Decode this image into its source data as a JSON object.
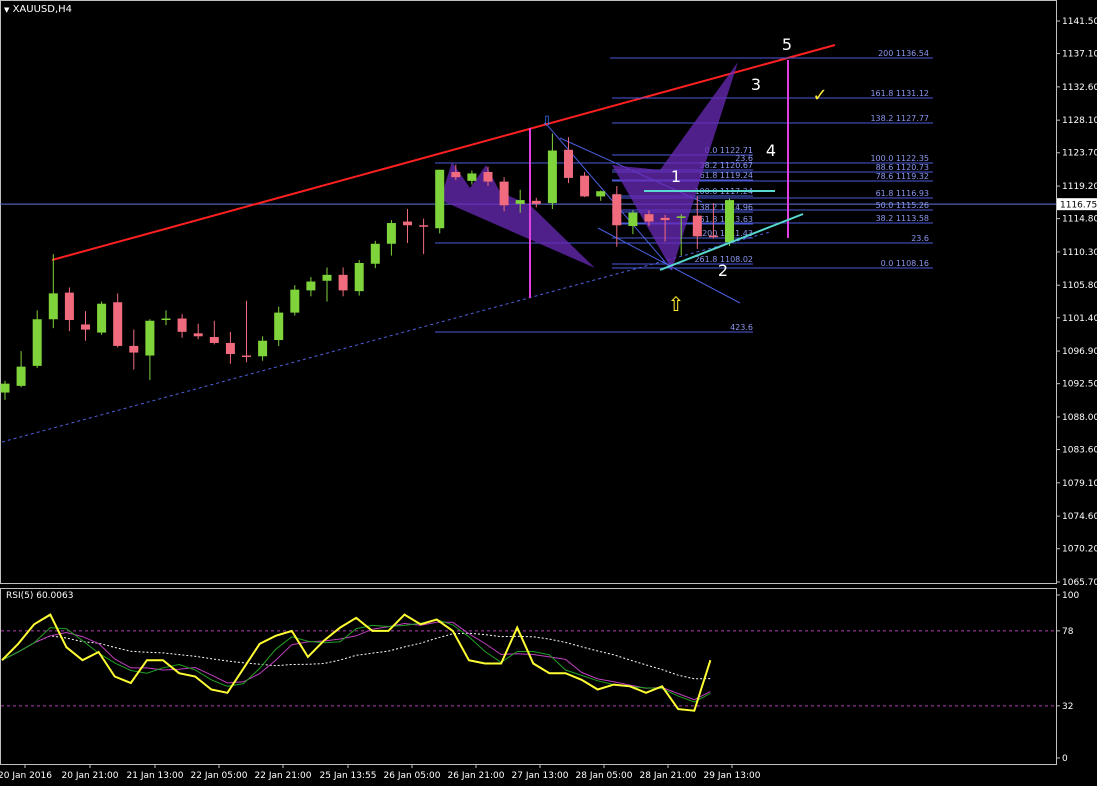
{
  "window": {
    "symbol_title": "XAUUSD,H4",
    "current_price": "1116.75"
  },
  "main_chart": {
    "price_ticks": [
      "1141.50",
      "1137.10",
      "1132.60",
      "1128.10",
      "1123.70",
      "1119.20",
      "1114.80",
      "1110.30",
      "1105.80",
      "1101.40",
      "1096.90",
      "1092.50",
      "1088.00",
      "1083.60",
      "1079.10",
      "1074.60",
      "1070.20",
      "1065.70"
    ],
    "time_ticks": [
      "20 Jan 2016",
      "20 Jan 21:00",
      "21 Jan 13:00",
      "22 Jan 05:00",
      "22 Jan 21:00",
      "25 Jan 13:55",
      "26 Jan 05:00",
      "26 Jan 21:00",
      "27 Jan 13:00",
      "28 Jan 05:00",
      "28 Jan 21:00",
      "29 Jan 13:00"
    ],
    "fib_upper": [
      {
        "label": "200 1136.54"
      },
      {
        "label": "161.8 1131.12"
      },
      {
        "label": "138.2 1127.77"
      },
      {
        "label": "100.0 1122.35"
      },
      {
        "label": "88.6 1120.73"
      },
      {
        "label": "78.6 1119.32"
      },
      {
        "label": "61.8 1116.93"
      },
      {
        "label": "50.0 1115.26"
      },
      {
        "label": "38.2 1113.58"
      },
      {
        "label": "23.6"
      },
      {
        "label": "0.0 1108.16"
      }
    ],
    "fib_lower": [
      {
        "label": "0.0 1122.71"
      },
      {
        "label": "23.6"
      },
      {
        "label": "38.2 1120.67"
      },
      {
        "label": "61.8 1119.24"
      },
      {
        "label": "100.0 1117.24"
      },
      {
        "label": "138.2 1114.96"
      },
      {
        "label": "161.8 1113.63"
      },
      {
        "label": "200 1111.43"
      },
      {
        "label": "261.8 1108.02"
      },
      {
        "label": "423.6"
      }
    ],
    "wave_labels": [
      "1",
      "2",
      "3",
      "4",
      "5"
    ],
    "icons": {
      "down_arrow": "blue-down-arrow-icon",
      "up_arrow": "yellow-up-arrow-icon",
      "check": "yellow-check-icon"
    },
    "colors": {
      "bull": "#7fd43b",
      "bear": "#f06b7d",
      "trendline": "#ff2020",
      "fib": "#4a5ad8",
      "pattern": "#6a2ab8",
      "vline": "#e040e0",
      "cyan": "#58d8d0",
      "current_line": "#5f74d8"
    }
  },
  "rsi_panel": {
    "title": "RSI(5) 60.0063",
    "ticks": [
      "100",
      "78",
      "32",
      "0"
    ]
  },
  "chart_data": [
    {
      "type": "candlestick",
      "title": "XAUUSD,H4",
      "ylim": [
        1065.7,
        1141.5
      ],
      "y_ticks": [
        1141.5,
        1137.1,
        1132.6,
        1128.1,
        1123.7,
        1119.2,
        1114.8,
        1110.3,
        1105.8,
        1101.4,
        1096.9,
        1092.5,
        1088.0,
        1083.6,
        1079.1,
        1074.6,
        1070.2,
        1065.7
      ],
      "x_labels": [
        "20 Jan 2016",
        "20 Jan 21:00",
        "21 Jan 13:00",
        "22 Jan 05:00",
        "22 Jan 21:00",
        "25 Jan 13:55",
        "26 Jan 05:00",
        "26 Jan 21:00",
        "27 Jan 13:00",
        "28 Jan 05:00",
        "28 Jan 21:00",
        "29 Jan 13:00"
      ],
      "last_price": 1116.75,
      "candles": [
        {
          "o": 1091.3,
          "h": 1092.9,
          "l": 1090.3,
          "c": 1092.5
        },
        {
          "o": 1092.2,
          "h": 1096.9,
          "l": 1092.0,
          "c": 1094.8
        },
        {
          "o": 1094.9,
          "h": 1102.4,
          "l": 1094.6,
          "c": 1101.2
        },
        {
          "o": 1101.2,
          "h": 1110.0,
          "l": 1100.0,
          "c": 1104.7
        },
        {
          "o": 1104.8,
          "h": 1105.5,
          "l": 1099.6,
          "c": 1101.1
        },
        {
          "o": 1100.5,
          "h": 1102.3,
          "l": 1098.3,
          "c": 1099.8
        },
        {
          "o": 1099.4,
          "h": 1103.6,
          "l": 1099.1,
          "c": 1103.3
        },
        {
          "o": 1103.5,
          "h": 1104.7,
          "l": 1097.4,
          "c": 1097.6
        },
        {
          "o": 1097.6,
          "h": 1099.8,
          "l": 1094.4,
          "c": 1096.7
        },
        {
          "o": 1096.3,
          "h": 1101.2,
          "l": 1093.0,
          "c": 1101.0
        },
        {
          "o": 1101.1,
          "h": 1102.4,
          "l": 1100.4,
          "c": 1101.3
        },
        {
          "o": 1101.3,
          "h": 1101.9,
          "l": 1098.7,
          "c": 1099.5
        },
        {
          "o": 1099.3,
          "h": 1100.6,
          "l": 1098.5,
          "c": 1098.9
        },
        {
          "o": 1098.8,
          "h": 1101.0,
          "l": 1097.8,
          "c": 1098.0
        },
        {
          "o": 1098.0,
          "h": 1099.5,
          "l": 1095.2,
          "c": 1096.5
        },
        {
          "o": 1096.3,
          "h": 1103.7,
          "l": 1095.4,
          "c": 1096.1
        },
        {
          "o": 1096.2,
          "h": 1098.9,
          "l": 1095.6,
          "c": 1098.3
        },
        {
          "o": 1098.4,
          "h": 1102.9,
          "l": 1097.6,
          "c": 1102.1
        },
        {
          "o": 1102.1,
          "h": 1105.8,
          "l": 1101.7,
          "c": 1105.2
        },
        {
          "o": 1105.1,
          "h": 1106.9,
          "l": 1104.3,
          "c": 1106.3
        },
        {
          "o": 1106.4,
          "h": 1108.2,
          "l": 1103.6,
          "c": 1107.2
        },
        {
          "o": 1107.2,
          "h": 1108.2,
          "l": 1104.3,
          "c": 1105.1
        },
        {
          "o": 1105.0,
          "h": 1109.2,
          "l": 1104.4,
          "c": 1108.8
        },
        {
          "o": 1108.7,
          "h": 1111.8,
          "l": 1108.1,
          "c": 1111.4
        },
        {
          "o": 1111.4,
          "h": 1114.6,
          "l": 1109.8,
          "c": 1114.2
        },
        {
          "o": 1114.4,
          "h": 1116.1,
          "l": 1111.5,
          "c": 1113.9
        },
        {
          "o": 1113.9,
          "h": 1114.8,
          "l": 1110.0,
          "c": 1113.8
        },
        {
          "o": 1113.5,
          "h": 1121.4,
          "l": 1112.8,
          "c": 1121.4
        },
        {
          "o": 1121.1,
          "h": 1122.1,
          "l": 1120.0,
          "c": 1120.4
        },
        {
          "o": 1119.9,
          "h": 1121.3,
          "l": 1119.4,
          "c": 1120.9
        },
        {
          "o": 1121.1,
          "h": 1121.8,
          "l": 1119.2,
          "c": 1119.8
        },
        {
          "o": 1119.8,
          "h": 1120.4,
          "l": 1115.8,
          "c": 1116.6
        },
        {
          "o": 1116.8,
          "h": 1118.7,
          "l": 1115.6,
          "c": 1117.3
        },
        {
          "o": 1117.2,
          "h": 1117.6,
          "l": 1116.3,
          "c": 1116.8
        },
        {
          "o": 1116.9,
          "h": 1126.3,
          "l": 1116.1,
          "c": 1124.0
        },
        {
          "o": 1124.1,
          "h": 1125.8,
          "l": 1119.6,
          "c": 1120.3
        },
        {
          "o": 1120.6,
          "h": 1121.1,
          "l": 1117.7,
          "c": 1117.8
        },
        {
          "o": 1117.8,
          "h": 1118.6,
          "l": 1117.2,
          "c": 1118.5
        },
        {
          "o": 1118.1,
          "h": 1119.2,
          "l": 1111.0,
          "c": 1113.9
        },
        {
          "o": 1113.8,
          "h": 1115.9,
          "l": 1112.7,
          "c": 1115.6
        },
        {
          "o": 1115.4,
          "h": 1115.9,
          "l": 1113.8,
          "c": 1114.4
        },
        {
          "o": 1114.9,
          "h": 1115.3,
          "l": 1111.7,
          "c": 1114.6
        },
        {
          "o": 1114.9,
          "h": 1115.4,
          "l": 1109.8,
          "c": 1115.1
        },
        {
          "o": 1115.2,
          "h": 1117.8,
          "l": 1110.7,
          "c": 1112.4
        },
        {
          "o": 1112.5,
          "h": 1116.9,
          "l": 1112.1,
          "c": 1112.3
        },
        {
          "o": 1111.6,
          "h": 1117.5,
          "l": 1111.1,
          "c": 1117.3
        }
      ]
    },
    {
      "type": "line",
      "title": "RSI(5) 60.0063",
      "ylim": [
        0,
        100
      ],
      "y_ticks": [
        100,
        78,
        32,
        0
      ],
      "levels": [
        78,
        32
      ],
      "series": [
        {
          "values": [
            60,
            70,
            82,
            88,
            68,
            60,
            65,
            50,
            46,
            60,
            60,
            52,
            50,
            42,
            40,
            55,
            70,
            75,
            78,
            62,
            72,
            80,
            86,
            78,
            78,
            88,
            82,
            85,
            78,
            60,
            58,
            58,
            80,
            58,
            52,
            52,
            48,
            42,
            45,
            44,
            40,
            44,
            30,
            29,
            60
          ]
        }
      ]
    }
  ]
}
